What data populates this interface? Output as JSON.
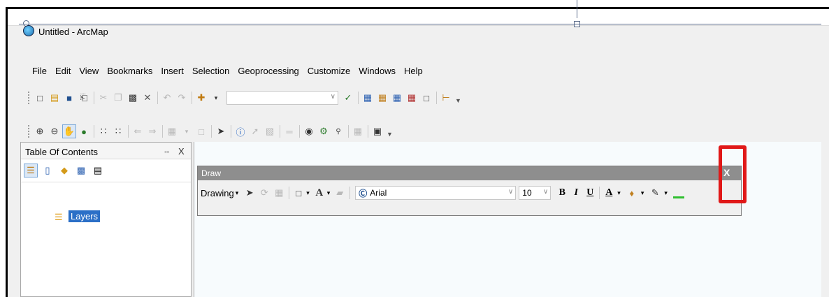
{
  "window": {
    "title": "Untitled - ArcMap"
  },
  "menu": [
    "File",
    "Edit",
    "View",
    "Bookmarks",
    "Insert",
    "Selection",
    "Geoprocessing",
    "Customize",
    "Windows",
    "Help"
  ],
  "toc": {
    "title": "Table Of Contents",
    "pin_glyph": "ⵧ",
    "close_glyph": "X",
    "layers_label": "Layers"
  },
  "draw_toolbar": {
    "title": "Draw",
    "close_glyph": "X",
    "drawing_menu": "Drawing",
    "font_name": "Arial",
    "font_size": "10",
    "bold": "B",
    "italic": "I",
    "underline": "U",
    "font_color_glyph": "A"
  },
  "colors": {
    "highlight": "#e01818",
    "title_bar_gray": "#8e8e8e",
    "selection": "#2b6fc7"
  }
}
